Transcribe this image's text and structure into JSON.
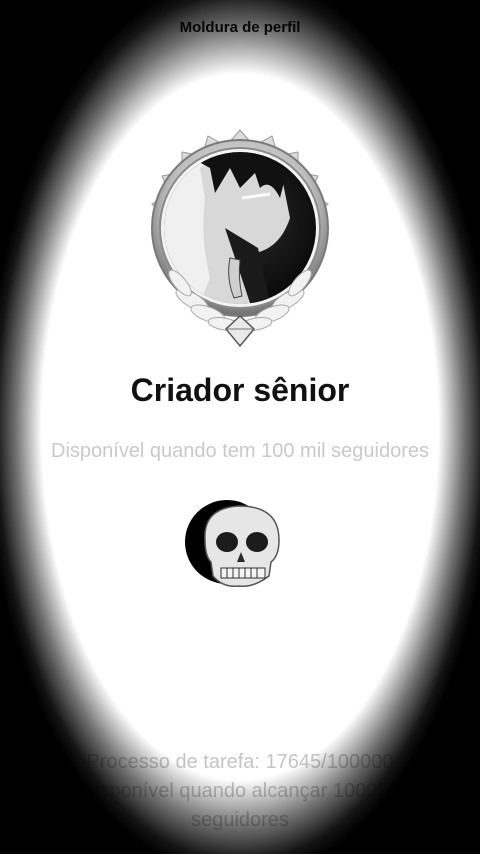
{
  "header": {
    "title": "Moldura de perfil",
    "back_icon": "arrow-left-icon"
  },
  "frame": {
    "image_icon": "silver-laurel-avatar-frame",
    "name": "Criador sênior",
    "description": "Disponível quando tem 100 mil seguidores"
  },
  "sticker": {
    "icon": "skull-icon"
  },
  "task": {
    "progress_label": "Processo de tarefa: 17645/100000",
    "progress_current": 17645,
    "progress_target": 100000,
    "condition": "Disponível quando alcançar 100000 seguidores"
  }
}
